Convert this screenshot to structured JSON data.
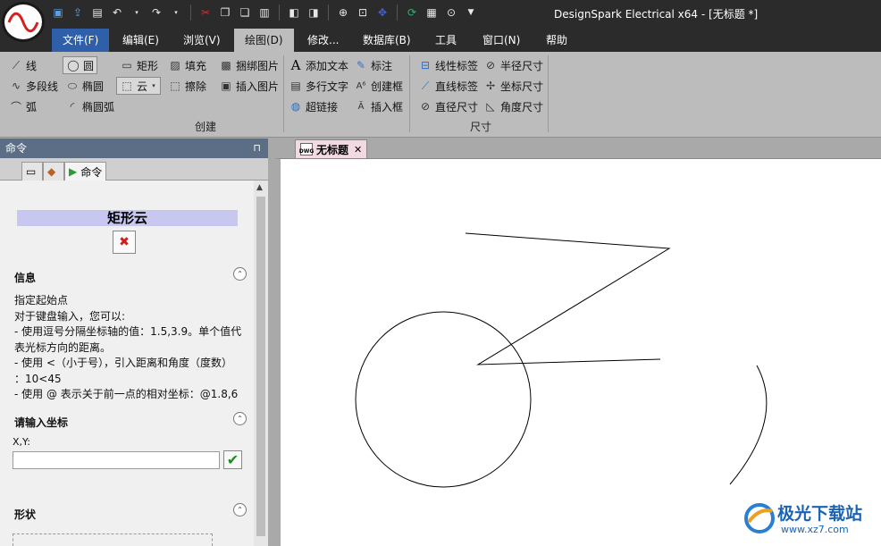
{
  "window": {
    "title": "DesignSpark Electrical x64 - [无标题 *]"
  },
  "menu": {
    "tabs": [
      {
        "label": "文件(F)"
      },
      {
        "label": "编辑(E)"
      },
      {
        "label": "浏览(V)"
      },
      {
        "label": "绘图(D)"
      },
      {
        "label": "修改..."
      },
      {
        "label": "数据库(B)"
      },
      {
        "label": "工具"
      },
      {
        "label": "窗口(N)"
      },
      {
        "label": "帮助"
      }
    ]
  },
  "ribbon": {
    "line": "线",
    "circle": "圆",
    "rectangle": "矩形",
    "fill": "填充",
    "bind_image": "捆绑图片",
    "polyline": "多段线",
    "ellipse": "椭圆",
    "cloud": "云",
    "erase": "擦除",
    "insert_image": "插入图片",
    "arc": "弧",
    "ellipse_arc": "椭圆弧",
    "group_create": "创建",
    "add_text": "添加文本",
    "multiline_text": "多行文字",
    "hyperlink": "超链接",
    "annotation": "标注",
    "create_frame": "创建框",
    "insert_frame": "插入框",
    "linear_label": "线性标签",
    "straight_label": "直线标签",
    "diameter_dim": "直径尺寸",
    "radius_dim": "半径尺寸",
    "coord_dim": "坐标尺寸",
    "angle_dim": "角度尺寸",
    "group_dimension": "尺寸"
  },
  "panel": {
    "header": "命令",
    "tab_command": "命令",
    "command_title": "矩形云",
    "info_head": "信息",
    "info_lines": [
      "指定起始点",
      "对于键盘输入，您可以:",
      "- 使用逗号分隔坐标轴的值：1.5,3.9。单个值代",
      "表光标方向的距离。",
      "- 使用 <（小于号），引入距离和角度（度数）",
      "：10<45",
      "- 使用 @ 表示关于前一点的相对坐标：@1.8,6"
    ],
    "coord_head": "请输入坐标",
    "xy_label": "X,Y:",
    "xy_value": "",
    "shape_head": "形状"
  },
  "document": {
    "tab_label": "无标题",
    "dwg_label": "DWG"
  },
  "watermark": {
    "text": "极光下载站",
    "url": "www.xz7.com"
  }
}
